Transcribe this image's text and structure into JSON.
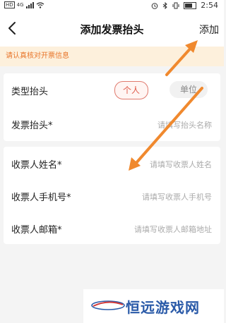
{
  "status_bar": {
    "time": "2:54",
    "network": "4G"
  },
  "header": {
    "title": "添加发票抬头",
    "action_label": "添加"
  },
  "notice": {
    "text": "请认真核对开票信息"
  },
  "invoice": {
    "type_label": "类型抬头",
    "type_options": [
      "个人",
      "单位"
    ],
    "selected_type": "个人",
    "title_label": "发票抬头*",
    "title_placeholder": "请填写抬头名称"
  },
  "recipient": {
    "name_label": "收票人姓名*",
    "name_placeholder": "请填写收票人姓名",
    "phone_label": "收票人手机号*",
    "phone_placeholder": "请填写收票人手机号",
    "email_label": "收票人邮箱*",
    "email_placeholder": "请填写收票人邮箱地址"
  },
  "watermark": {
    "text": "恒远游戏网"
  },
  "colors": {
    "accent": "#e8752a",
    "selected": "#e05a4a",
    "arrow": "#f0892e"
  }
}
